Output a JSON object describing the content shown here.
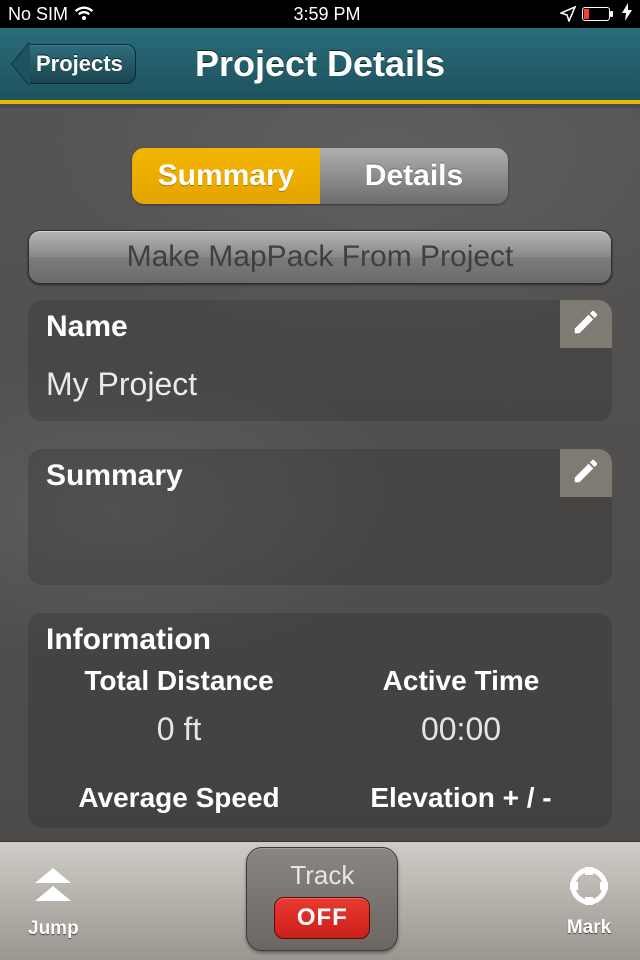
{
  "status": {
    "carrier": "No SIM",
    "time": "3:59 PM"
  },
  "nav": {
    "back_label": "Projects",
    "title": "Project Details"
  },
  "tabs": {
    "summary": "Summary",
    "details": "Details",
    "active": "summary"
  },
  "actions": {
    "make_mappack": "Make MapPack From Project"
  },
  "name_card": {
    "title": "Name",
    "value": "My Project"
  },
  "summary_card": {
    "title": "Summary",
    "value": ""
  },
  "info": {
    "title": "Information",
    "stats": {
      "total_distance_label": "Total Distance",
      "total_distance_value": "0 ft",
      "active_time_label": "Active Time",
      "active_time_value": "00:00",
      "avg_speed_label": "Average Speed",
      "elevation_label": "Elevation + / -"
    }
  },
  "toolbar": {
    "jump": "Jump",
    "track": "Track",
    "track_state": "OFF",
    "mark": "Mark"
  }
}
